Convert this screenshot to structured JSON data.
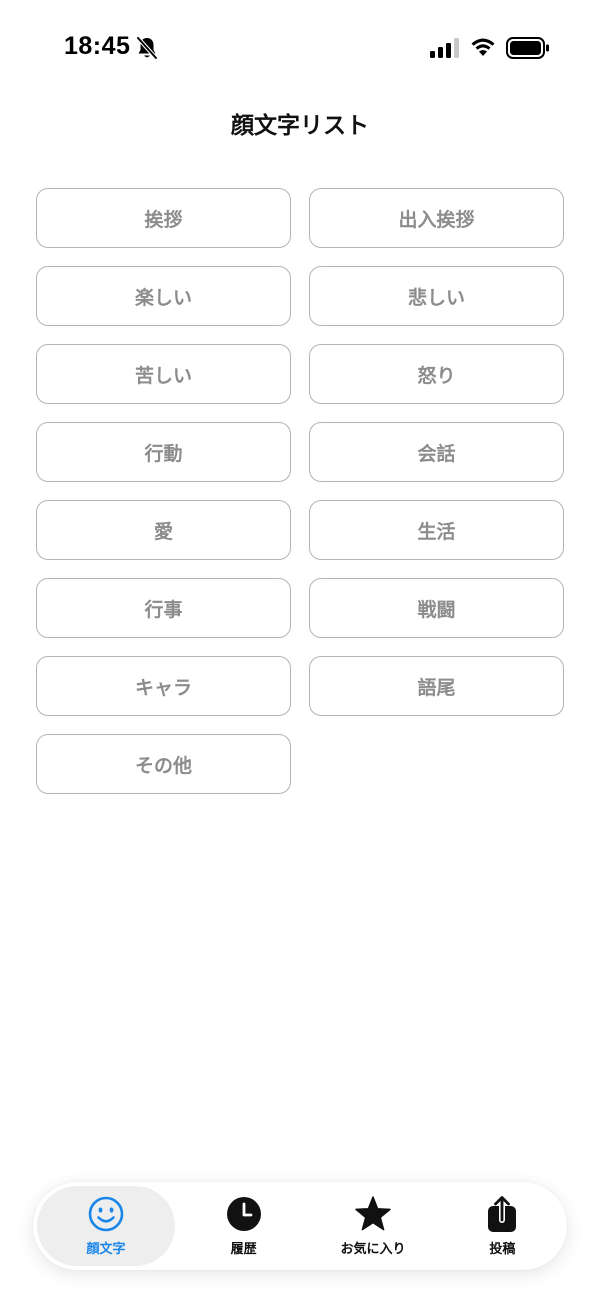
{
  "status_bar": {
    "time": "18:45"
  },
  "header": {
    "title": "顔文字リスト"
  },
  "categories": [
    {
      "label": "挨拶"
    },
    {
      "label": "出入挨拶"
    },
    {
      "label": "楽しい"
    },
    {
      "label": "悲しい"
    },
    {
      "label": "苦しい"
    },
    {
      "label": "怒り"
    },
    {
      "label": "行動"
    },
    {
      "label": "会話"
    },
    {
      "label": "愛"
    },
    {
      "label": "生活"
    },
    {
      "label": "行事"
    },
    {
      "label": "戦闘"
    },
    {
      "label": "キャラ"
    },
    {
      "label": "語尾"
    },
    {
      "label": "その他"
    }
  ],
  "tab_bar": {
    "active_color": "#1a86e8",
    "items": [
      {
        "label": "顔文字",
        "icon": "smiley-icon",
        "active": true
      },
      {
        "label": "履歴",
        "icon": "clock-icon",
        "active": false
      },
      {
        "label": "お気に入り",
        "icon": "star-icon",
        "active": false
      },
      {
        "label": "投稿",
        "icon": "share-icon",
        "active": false
      }
    ]
  }
}
